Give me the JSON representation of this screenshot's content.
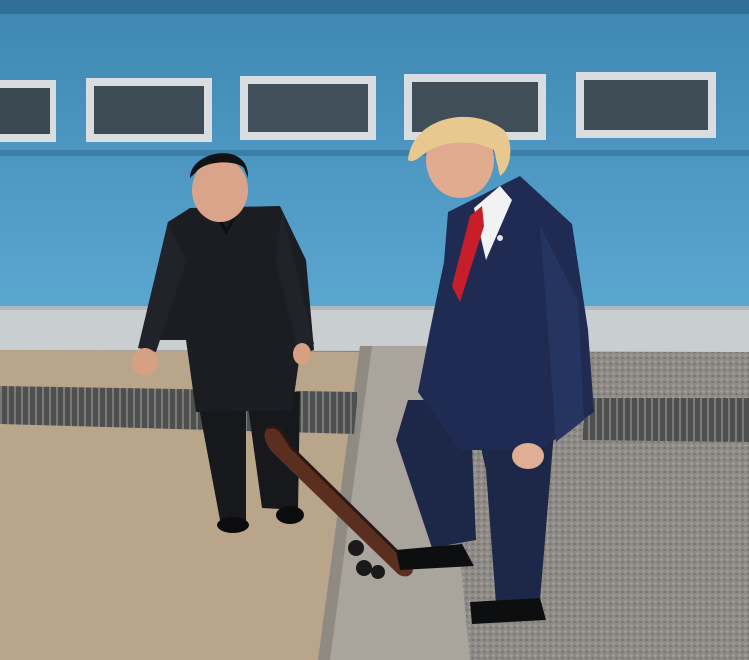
{
  "photo": {
    "subject": "two-men-standing-by-skateboard",
    "palette": {
      "wall": "#4f9ec9",
      "wall_dark": "#3c84ae",
      "wall_base": "#c9cfd1",
      "ground_sand": "#b9a58a",
      "curb": "#a9a59c",
      "gravel": "#8e8b86",
      "grate": "#5f605f",
      "dark_suit": "#1b1d22",
      "navy_suit": "#1f2b52",
      "red_tie": "#c81e2a",
      "skin": "#d9a48a",
      "blond_hair": "#e7c98f",
      "skateboard_deck": "#5a2f20"
    }
  }
}
